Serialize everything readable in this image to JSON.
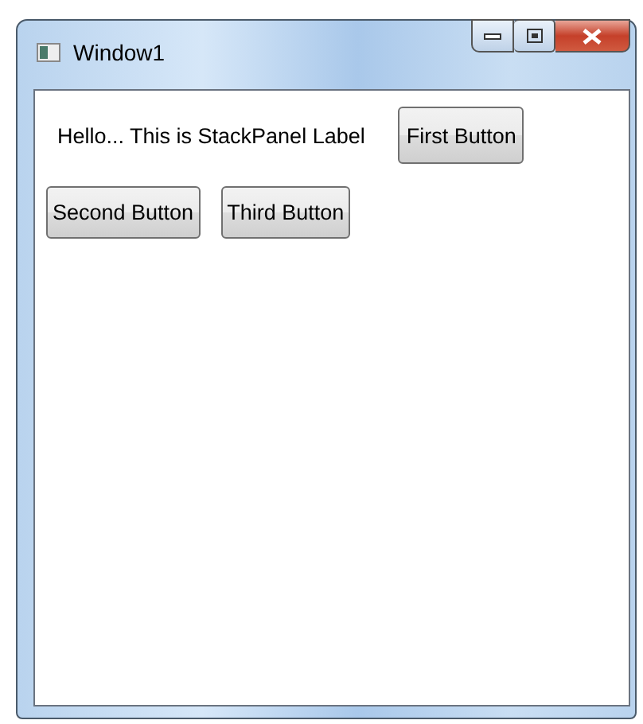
{
  "window": {
    "title": "Window1"
  },
  "rows": [
    {
      "label": "Hello... This is StackPanel Label",
      "buttons": [
        "First Button"
      ]
    },
    {
      "buttons": [
        "Second Button",
        "Third Button"
      ]
    }
  ]
}
